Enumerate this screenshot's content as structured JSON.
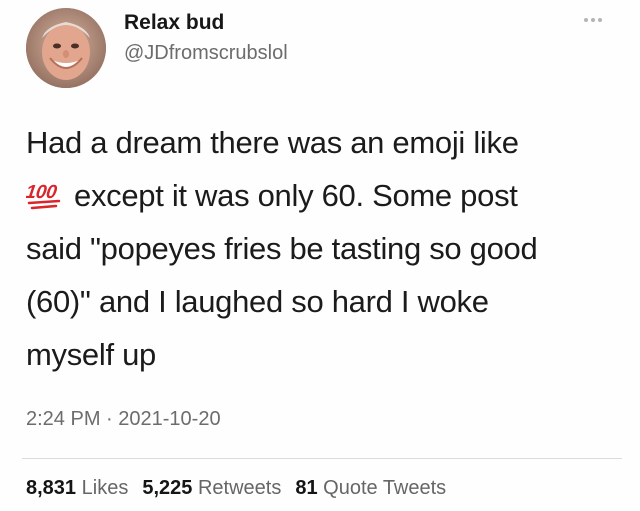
{
  "author": {
    "name": "Relax bud",
    "handle": "@JDfromscrubslol"
  },
  "tweet": {
    "line1": "Had a dream there was an emoji like",
    "emoji_name": "hundred-points-emoji",
    "emoji_glyph": "100",
    "line2_after_emoji": "except it was only 60. Some post",
    "line3": "said \"popeyes fries be tasting so good",
    "line4": "(60)\" and I laughed so hard I woke",
    "line5": "myself up"
  },
  "timestamp": "2:24 PM · 2021-10-20",
  "stats": {
    "likes_count": "8,831",
    "likes_label": "Likes",
    "retweets_count": "5,225",
    "retweets_label": "Retweets",
    "quotes_count": "81",
    "quotes_label": "Quote Tweets"
  },
  "colors": {
    "emoji_red": "#d8262b",
    "handle_gray": "#6c6c6c"
  },
  "icons": {
    "more": "more-options-icon"
  }
}
